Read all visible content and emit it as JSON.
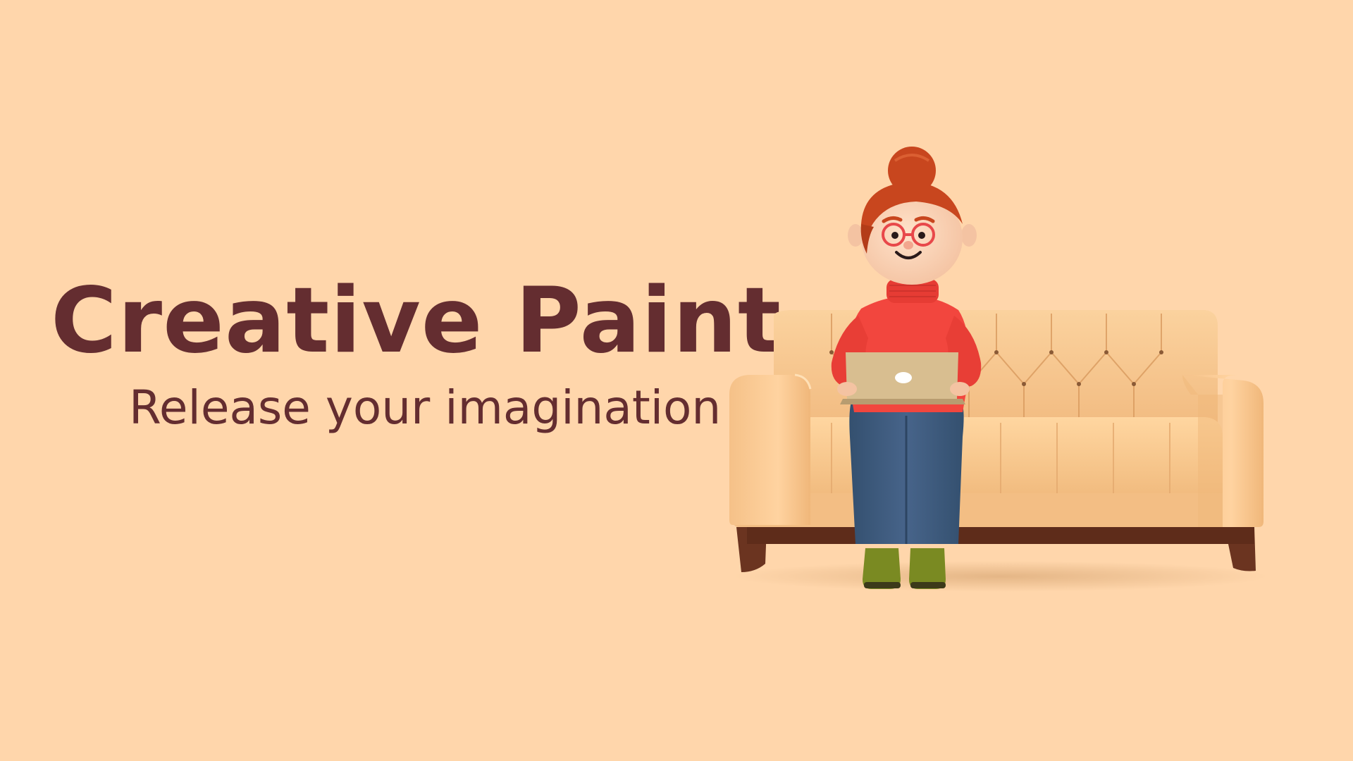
{
  "hero": {
    "title": "Creative Paint",
    "tagline": "Release your imagination"
  },
  "illustration": {
    "subject": "person-on-sofa-with-laptop",
    "colors": {
      "background": "#FFD6AB",
      "text": "#642D30",
      "sofa": "#F6C48A",
      "sofa_legs": "#6B3420",
      "sweater": "#F2463E",
      "pants": "#3E5A7E",
      "shoes": "#7A8A22",
      "hair": "#C8461E",
      "laptop": "#D8BE90"
    }
  }
}
